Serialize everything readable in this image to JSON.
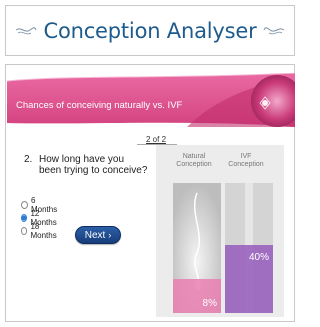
{
  "header": {
    "title": "Conception Analyser"
  },
  "banner": {
    "text": "Chances of conceiving naturally vs. IVF",
    "logo_icon": "heart-flower-icon"
  },
  "pager": {
    "text": "2 of 2"
  },
  "question": {
    "number": "2.",
    "text": "How long have you been trying to conceive?"
  },
  "options": [
    {
      "label": "6 Months",
      "selected": false
    },
    {
      "label": "12 Months",
      "selected": true
    },
    {
      "label": "18 Months",
      "selected": false
    }
  ],
  "next_button": {
    "label": "Next",
    "icon": "chevron-right-icon"
  },
  "chart_data": {
    "type": "bar",
    "categories": [
      "Natural Conception",
      "IVF Conception"
    ],
    "values": [
      8,
      40
    ],
    "value_labels": [
      "8%",
      "40%"
    ],
    "ylim": [
      0,
      100
    ]
  },
  "colors": {
    "brand_blue": "#1e5b8d",
    "banner_pink": "#e0528f",
    "natural_fill": "#e97fb0",
    "ivf_fill": "#9a63be"
  }
}
